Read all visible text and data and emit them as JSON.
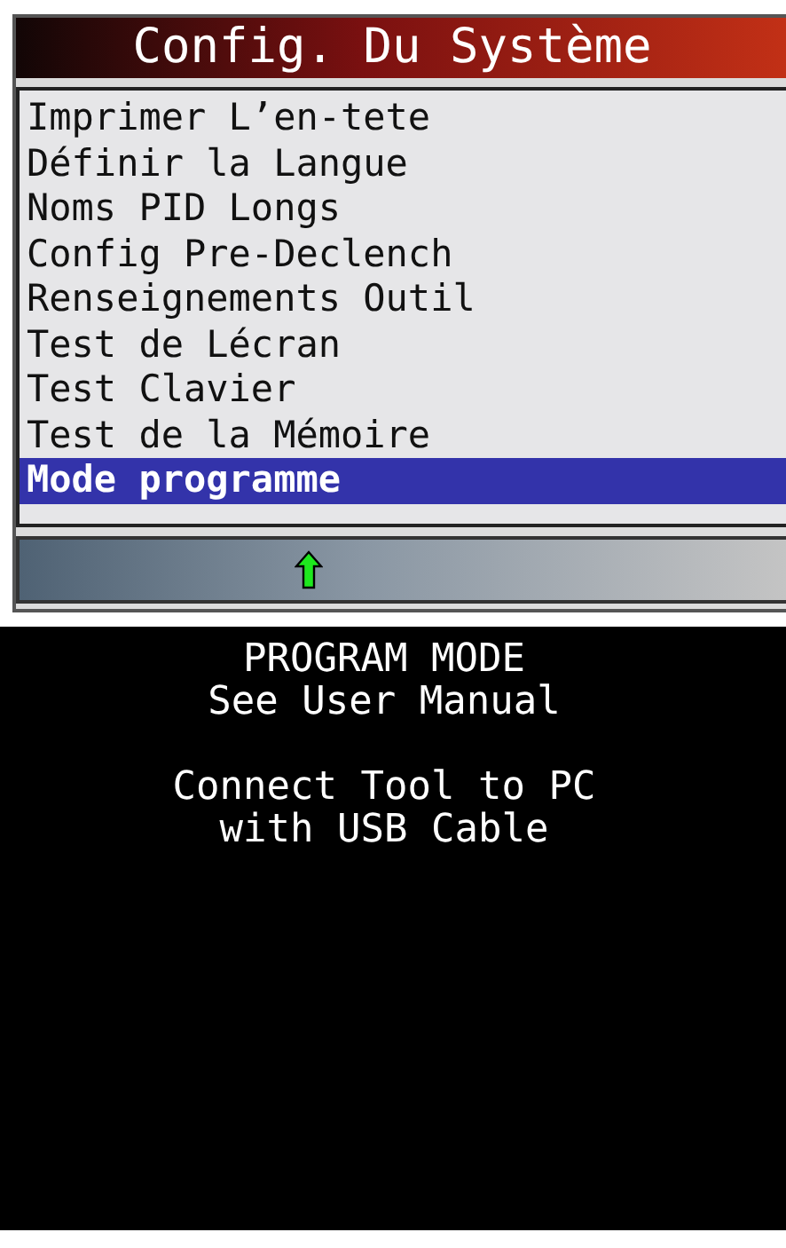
{
  "window": {
    "title": "Config. Du Système"
  },
  "menu": [
    {
      "label": "Imprimer L’en-tete",
      "selected": false
    },
    {
      "label": "Définir la Langue",
      "selected": false
    },
    {
      "label": "Noms PID Longs",
      "selected": false
    },
    {
      "label": "Config Pre-Declench",
      "selected": false
    },
    {
      "label": "Renseignements Outil",
      "selected": false
    },
    {
      "label": "Test de Lécran",
      "selected": false
    },
    {
      "label": "Test Clavier",
      "selected": false
    },
    {
      "label": "Test de la Mémoire",
      "selected": false
    },
    {
      "label": "Mode programme",
      "selected": true
    }
  ],
  "message": [
    {
      "text": "PROGRAM MODE\nSee User Manual"
    },
    {
      "text": "Connect Tool to PC\nwith USB Cable"
    }
  ]
}
